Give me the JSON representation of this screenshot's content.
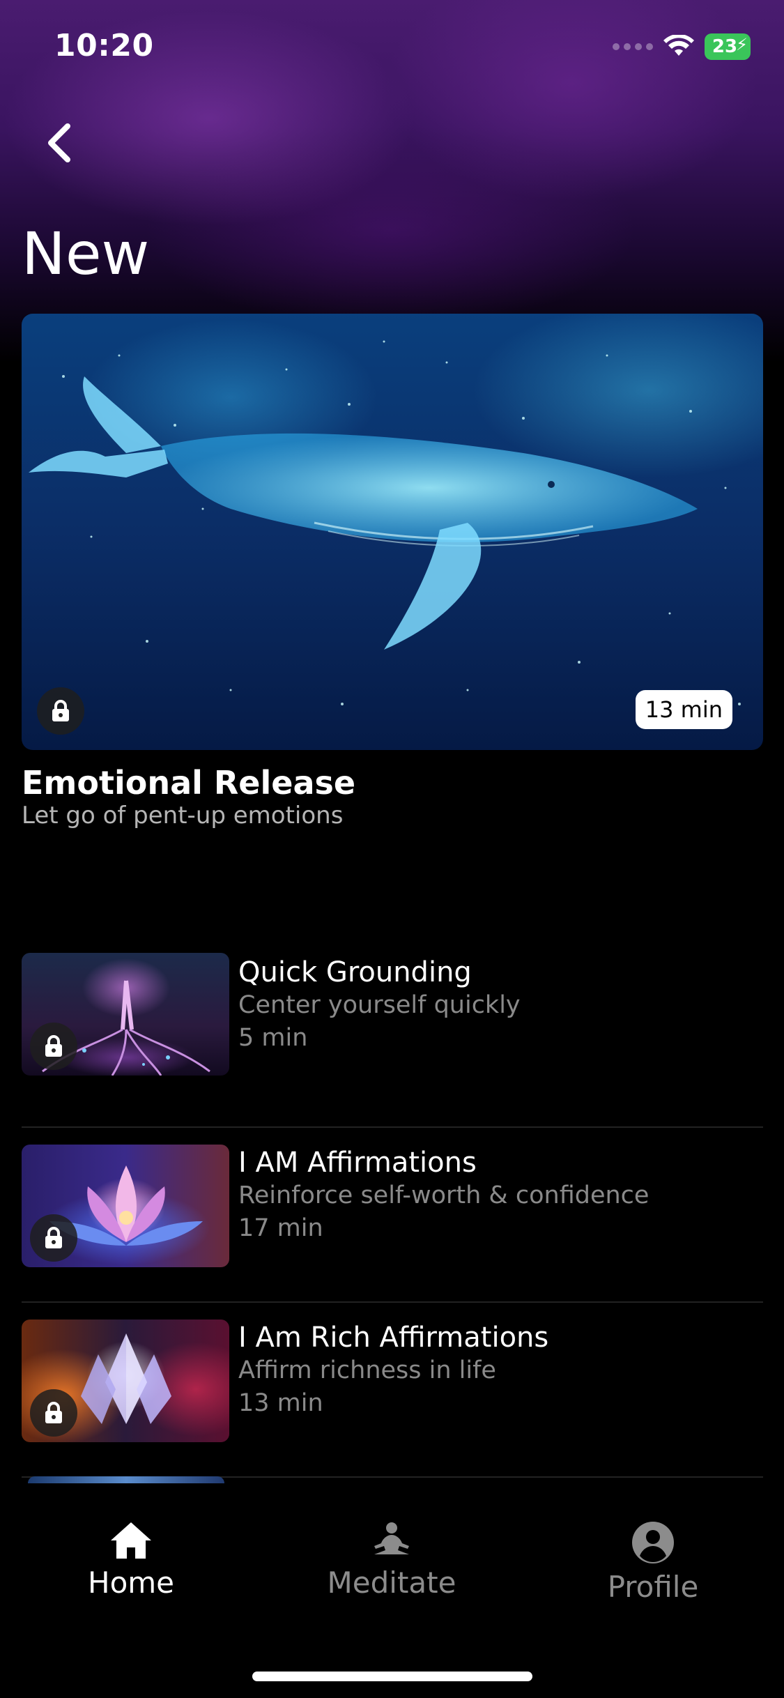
{
  "status_bar": {
    "time": "10:20",
    "battery": "23"
  },
  "page": {
    "title": "New"
  },
  "featured": {
    "title": "Emotional Release",
    "subtitle": "Let go of pent-up emotions",
    "duration": "13 min",
    "locked": true,
    "image": "glowing-cosmic-whale"
  },
  "items": [
    {
      "title": "Quick Grounding",
      "subtitle": "Center yourself quickly",
      "duration": "5 min",
      "locked": true,
      "image": "glowing-tree-roots"
    },
    {
      "title": "I AM Affirmations",
      "subtitle": "Reinforce self-worth & confidence",
      "duration": "17 min",
      "locked": true,
      "image": "glowing-lotus"
    },
    {
      "title": "I Am Rich Affirmations",
      "subtitle": "Affirm richness in life",
      "duration": "13 min",
      "locked": true,
      "image": "glowing-crystal"
    }
  ],
  "tab_bar": {
    "tabs": [
      {
        "label": "Home",
        "icon": "home-icon",
        "active": true
      },
      {
        "label": "Meditate",
        "icon": "meditate-icon",
        "active": false
      },
      {
        "label": "Profile",
        "icon": "profile-icon",
        "active": false
      }
    ]
  },
  "colors": {
    "background": "#000000",
    "header_gradient_top": "#4a1c70",
    "subtitle_gray": "#8a8a8a",
    "battery_green": "#3ac55a"
  }
}
